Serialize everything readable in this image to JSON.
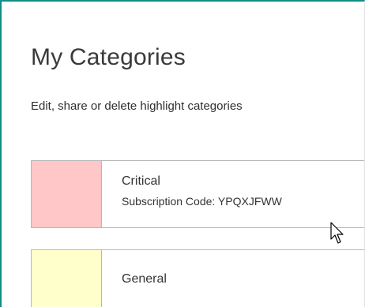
{
  "page": {
    "title": "My Categories",
    "subtitle": "Edit, share or delete highlight categories"
  },
  "categories": [
    {
      "name": "Critical",
      "code_text": "Subscription Code: YPQXJFWW",
      "color": "#ffc7c7"
    },
    {
      "name": "General",
      "color": "#ffffcc"
    }
  ],
  "colors": {
    "frame_accent": "#0f8f86",
    "card_border": "#b7b7b7",
    "text": "#333333"
  },
  "icons": {
    "cursor": "mouse-pointer-icon"
  }
}
